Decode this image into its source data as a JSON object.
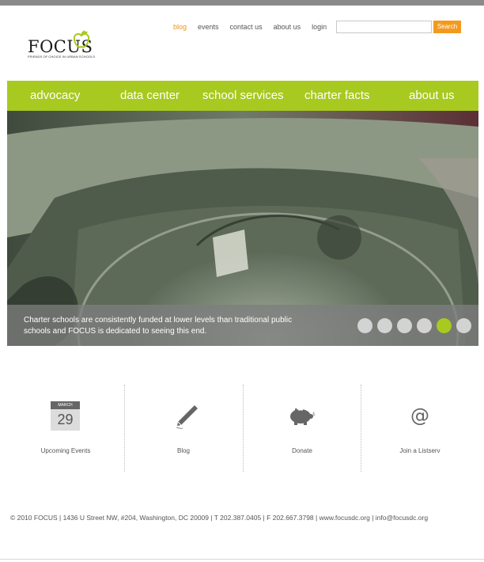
{
  "logo": {
    "word": "FOCUS",
    "tagline": "FRIENDS OF CHOICE IN URBAN SCHOOLS"
  },
  "top_nav": {
    "items": [
      "blog",
      "events",
      "contact us",
      "about us",
      "login"
    ],
    "active": "blog"
  },
  "search": {
    "value": "",
    "placeholder": "",
    "button_label": "Search"
  },
  "main_nav": {
    "items": [
      "advocacy",
      "data center",
      "school services",
      "charter facts",
      "about us"
    ]
  },
  "hero": {
    "caption": "Charter schools are consistently funded at lower levels than traditional public schools and FOCUS is dedicated to seeing this end.",
    "slide_count": 6,
    "active_slide": 5
  },
  "features": [
    {
      "label": "Upcoming Events",
      "icon": "calendar-icon",
      "calendar_month": "MARCH",
      "calendar_day": "29"
    },
    {
      "label": "Blog",
      "icon": "pen-icon"
    },
    {
      "label": "Donate",
      "icon": "piggy-bank-icon"
    },
    {
      "label": "Join a Listserv",
      "icon": "at-sign-icon"
    }
  ],
  "footer": {
    "text": "© 2010 FOCUS | 1436 U Street NW, #204, Washington, DC 20009 | T 202.387.0405 | F 202.667.3798 | www.focusdc.org | info@focusdc.org"
  },
  "colors": {
    "accent_green": "#a8c920",
    "accent_orange": "#f39a1e",
    "top_bar": "#8a8a8a"
  }
}
